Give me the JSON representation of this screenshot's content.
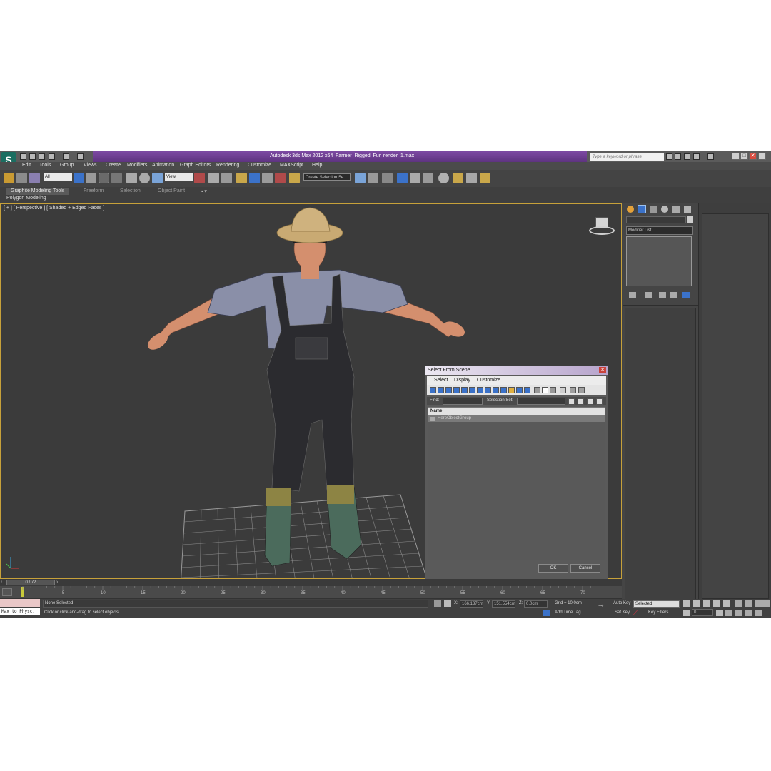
{
  "window": {
    "app_title": "Autodesk 3ds Max  2012 x64",
    "file_name": "Farmer_Rigged_Fur_render_1.max",
    "search_placeholder": "Type a keyword or phrase"
  },
  "menu": [
    "Edit",
    "Tools",
    "Group",
    "Views",
    "Create",
    "Modifiers",
    "Animation",
    "Graph Editors",
    "Rendering",
    "Customize",
    "MAXScript",
    "Help"
  ],
  "toolbar": {
    "selection_filter": "All",
    "reference_coord": "View",
    "named_selection_set": "Create Selection Se"
  },
  "ribbon": {
    "tabs": [
      "Graphite Modeling Tools",
      "Freeform",
      "Selection",
      "Object Paint"
    ],
    "active_panel": "Polygon Modeling"
  },
  "viewport": {
    "label": "[ + ] [ Perspective ] [ Shaded + Edged Faces ]"
  },
  "command_panel": {
    "modifier_list": "Modifier List"
  },
  "dialog": {
    "title": "Select From Scene",
    "menu": [
      "Select",
      "Display",
      "Customize"
    ],
    "find_label": "Find:",
    "selection_set_label": "Selection Set:",
    "column_name": "Name",
    "rows": [
      "HeroObjectGroup"
    ],
    "ok": "OK",
    "cancel": "Cancel"
  },
  "timeline": {
    "position": "0 / 72",
    "ticks": [
      "5",
      "10",
      "15",
      "20",
      "25",
      "30",
      "35",
      "40",
      "45",
      "50",
      "55",
      "60",
      "65",
      "70"
    ]
  },
  "status": {
    "maxscript": "Max to Physc.",
    "selection": "None Selected",
    "prompt": "Click or click-and-drag to select objects",
    "x_value": "166,137cm",
    "y_value": "151,554cm",
    "z_value": "0,0cm",
    "x_label": "X:",
    "y_label": "Y:",
    "z_label": "Z:",
    "grid": "Grid = 10,0cm",
    "add_time_tag": "Add Time Tag",
    "auto_key": "Auto Key",
    "set_key": "Set Key",
    "key_mode": "Selected",
    "key_filters": "Key Filters...",
    "frame": "0"
  }
}
